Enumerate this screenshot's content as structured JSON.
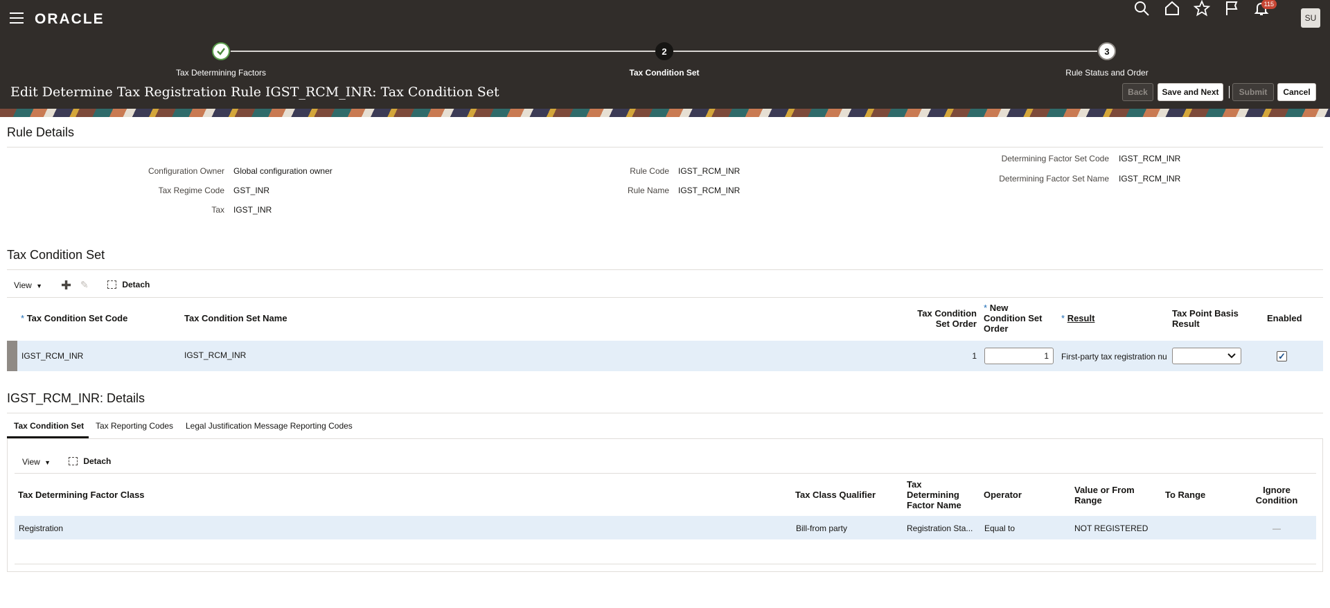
{
  "app": {
    "logo": "ORACLE",
    "avatar": "SU",
    "notifications": "115"
  },
  "train": {
    "steps": [
      {
        "label": "Tax Determining Factors",
        "marker": "✓",
        "state": "done"
      },
      {
        "label": "Tax Condition Set",
        "marker": "2",
        "state": "current"
      },
      {
        "label": "Rule Status and Order",
        "marker": "3",
        "state": "todo"
      }
    ]
  },
  "page": {
    "title": "Edit Determine Tax Registration Rule IGST_RCM_INR: Tax Condition Set",
    "buttons": {
      "back": "Back",
      "save_next": "Save and Next",
      "submit": "Submit",
      "cancel": "Cancel"
    }
  },
  "rule_details": {
    "heading": "Rule Details",
    "fields": {
      "config_owner_label": "Configuration Owner",
      "config_owner": "Global configuration owner",
      "regime_label": "Tax Regime Code",
      "regime": "GST_INR",
      "tax_label": "Tax",
      "tax": "IGST_INR",
      "rule_code_label": "Rule Code",
      "rule_code": "IGST_RCM_INR",
      "rule_name_label": "Rule Name",
      "rule_name": "IGST_RCM_INR",
      "dfs_code_label": "Determining Factor Set Code",
      "dfs_code": "IGST_RCM_INR",
      "dfs_name_label": "Determining Factor Set Name",
      "dfs_name": "IGST_RCM_INR"
    }
  },
  "condition_set": {
    "heading": "Tax Condition Set",
    "toolbar": {
      "view": "View",
      "detach": "Detach"
    },
    "columns": {
      "code": "Tax Condition Set Code",
      "name": "Tax Condition Set Name",
      "order_l1": "Tax Condition",
      "order_l2": "Set Order",
      "new_l1": "New",
      "new_l2": "Condition Set",
      "new_l3": "Order",
      "result": "Result",
      "tpb_l1": "Tax Point Basis",
      "tpb_l2": "Result",
      "enabled": "Enabled"
    },
    "row": {
      "code": "IGST_RCM_INR",
      "name": "IGST_RCM_INR",
      "order": "1",
      "new_order": "1",
      "result": "First-party tax registration nu",
      "enabled": "✓"
    }
  },
  "details": {
    "heading": "IGST_RCM_INR: Details",
    "tabs": [
      "Tax Condition Set",
      "Tax Reporting Codes",
      "Legal Justification Message Reporting Codes"
    ],
    "toolbar": {
      "view": "View",
      "detach": "Detach"
    },
    "columns": {
      "factor_class": "Tax Determining Factor Class",
      "qualifier": "Tax Class Qualifier",
      "fname_l1": "Tax",
      "fname_l2": "Determining",
      "fname_l3": "Factor Name",
      "operator": "Operator",
      "value_l1": "Value or From",
      "value_l2": "Range",
      "to_range": "To Range",
      "ignore_l1": "Ignore",
      "ignore_l2": "Condition"
    },
    "row": {
      "factor_class": "Registration",
      "qualifier": "Bill-from party",
      "fname": "Registration Sta...",
      "operator": "Equal to",
      "value": "NOT REGISTERED",
      "to_range": "",
      "ignore": "—"
    }
  }
}
